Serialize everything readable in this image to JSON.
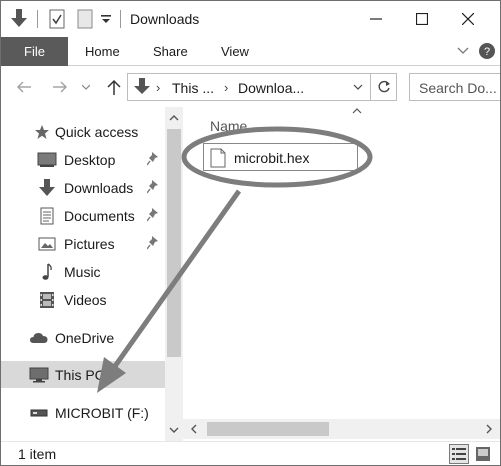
{
  "window": {
    "title": "Downloads"
  },
  "ribbon": {
    "tabs": [
      "File",
      "Home",
      "Share",
      "View"
    ]
  },
  "address": {
    "segments": [
      "This ...",
      "Downloa..."
    ],
    "search_placeholder": "Search Do..."
  },
  "nav": {
    "items": [
      {
        "label": "Quick access",
        "icon": "star-icon",
        "pinned": false
      },
      {
        "label": "Desktop",
        "icon": "desktop-icon",
        "pinned": true
      },
      {
        "label": "Downloads",
        "icon": "download-arrow-icon",
        "pinned": true
      },
      {
        "label": "Documents",
        "icon": "document-icon",
        "pinned": true
      },
      {
        "label": "Pictures",
        "icon": "picture-icon",
        "pinned": true
      },
      {
        "label": "Music",
        "icon": "music-note-icon",
        "pinned": false
      },
      {
        "label": "Videos",
        "icon": "film-icon",
        "pinned": false
      },
      {
        "label": "OneDrive",
        "icon": "cloud-icon",
        "pinned": false
      },
      {
        "label": "This PC",
        "icon": "monitor-icon",
        "pinned": false,
        "selected": true
      },
      {
        "label": "MICROBIT (F:)",
        "icon": "drive-icon",
        "pinned": false
      }
    ]
  },
  "files": {
    "column_name": "Name",
    "items": [
      {
        "name": "microbit.hex",
        "icon": "file-icon",
        "selected": true
      }
    ]
  },
  "status": {
    "item_count": "1 item"
  },
  "colors": {
    "file_tab_bg": "#5a5a5a",
    "selection": "#d9d9d9",
    "annotation": "#7d7d7d"
  }
}
